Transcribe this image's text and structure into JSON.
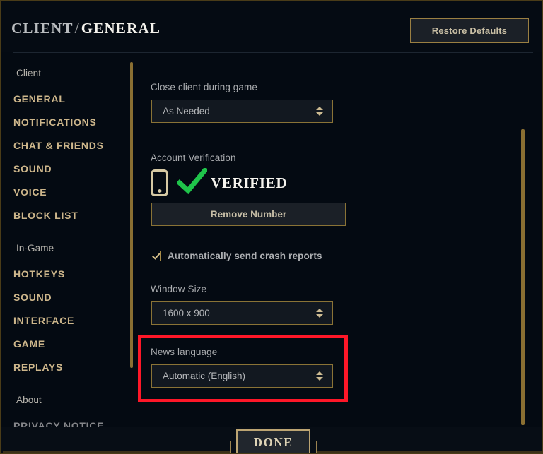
{
  "header": {
    "breadcrumb_parent": "CLIENT",
    "breadcrumb_separator": "/",
    "breadcrumb_current": "GENERAL",
    "restore_defaults_label": "Restore Defaults"
  },
  "sidebar": {
    "groups": [
      {
        "label": "Client",
        "items": [
          {
            "label": "GENERAL"
          },
          {
            "label": "NOTIFICATIONS"
          },
          {
            "label": "CHAT & FRIENDS"
          },
          {
            "label": "SOUND"
          },
          {
            "label": "VOICE"
          },
          {
            "label": "BLOCK LIST"
          }
        ]
      },
      {
        "label": "In-Game",
        "items": [
          {
            "label": "HOTKEYS"
          },
          {
            "label": "SOUND"
          },
          {
            "label": "INTERFACE"
          },
          {
            "label": "GAME"
          },
          {
            "label": "REPLAYS"
          }
        ]
      },
      {
        "label": "About",
        "items": [
          {
            "label": "PRIVACY NOTICE"
          }
        ]
      }
    ]
  },
  "main": {
    "close_client": {
      "label": "Close client during game",
      "value": "As Needed"
    },
    "account_verification": {
      "label": "Account Verification",
      "status": "VERIFIED",
      "remove_number_label": "Remove Number",
      "phone_icon": "phone-icon",
      "check_icon": "green-check-icon"
    },
    "crash_reports": {
      "label": "Automatically send crash reports",
      "checked": true
    },
    "window_size": {
      "label": "Window Size",
      "value": "1600 x 900"
    },
    "news_language": {
      "label": "News language",
      "value": "Automatic (English)"
    }
  },
  "footer": {
    "done_label": "DONE"
  },
  "colors": {
    "background": "#040a12",
    "accent_gold": "#8a7336",
    "gold_text": "#cdb68b",
    "scrollbar": "#8a6f32",
    "annotation_red": "#fe1728",
    "verified_green": "#1fc44a",
    "control_fill": "#121820"
  }
}
